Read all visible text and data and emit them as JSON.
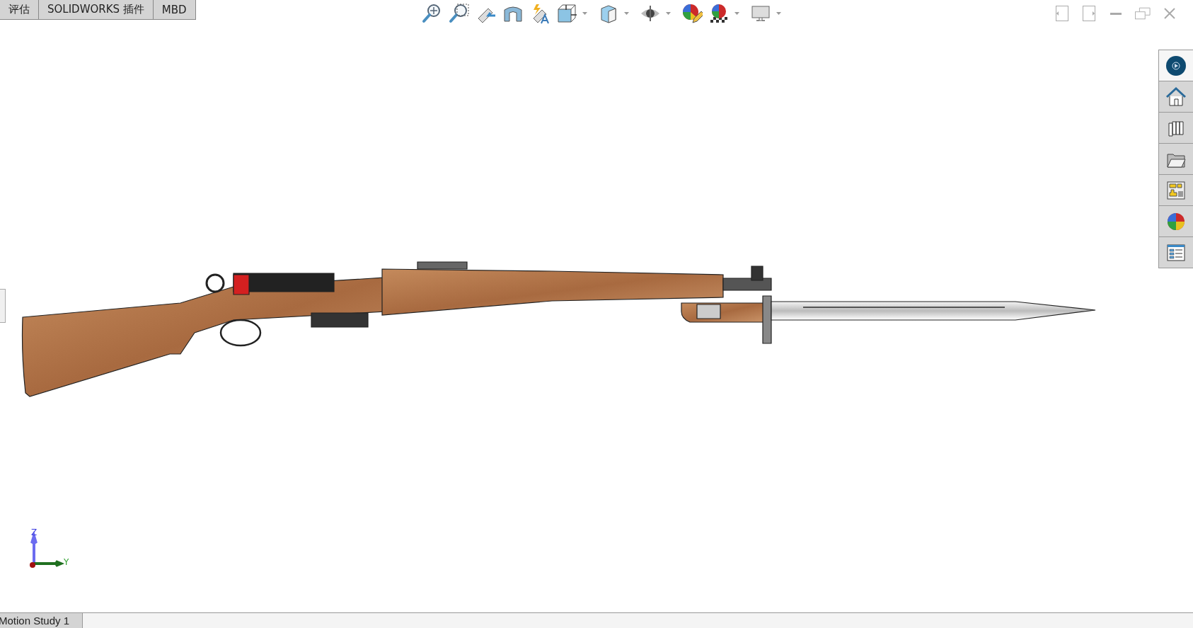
{
  "tabs": [
    {
      "label": "评估",
      "selected": false
    },
    {
      "label": "SOLIDWORKS 插件",
      "selected": false
    },
    {
      "label": "MBD",
      "selected": false
    }
  ],
  "triad": {
    "z_label": "Z",
    "y_label": "Y"
  },
  "task_pane": [
    {
      "selected": true
    },
    {
      "selected": false
    },
    {
      "selected": false
    },
    {
      "selected": false
    },
    {
      "selected": false
    },
    {
      "selected": false
    },
    {
      "selected": false
    }
  ],
  "bottom_tabs": [
    {
      "label": "Motion Study 1",
      "selected": false
    }
  ]
}
